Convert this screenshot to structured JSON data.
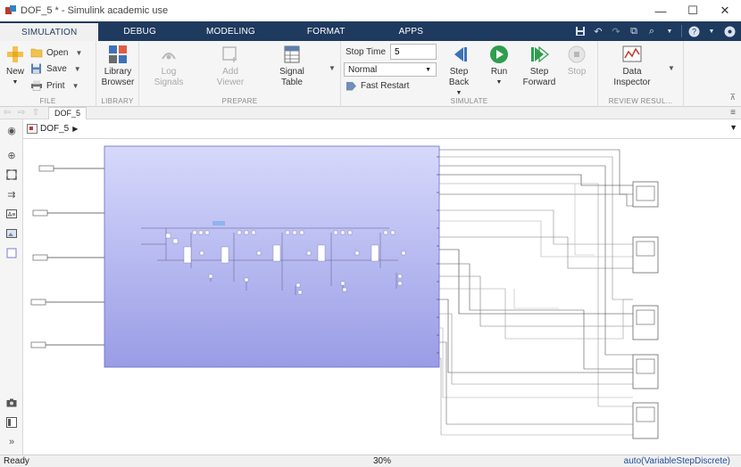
{
  "window": {
    "title": "DOF_5 * - Simulink academic use",
    "minimize": "—",
    "maximize": "☐",
    "close": "✕"
  },
  "tabs": [
    "SIMULATION",
    "DEBUG",
    "MODELING",
    "FORMAT",
    "APPS"
  ],
  "quick_access": {
    "save_icon": "save-icon",
    "undo_icon": "undo-icon",
    "redo_icon": "redo-icon",
    "search_icon": "search-icon",
    "help_icon": "help-icon"
  },
  "ribbon": {
    "file": {
      "label": "FILE",
      "new": "New",
      "open": "Open",
      "save": "Save",
      "print": "Print"
    },
    "library": {
      "label": "LIBRARY",
      "browser": "Library Browser"
    },
    "prepare": {
      "label": "PREPARE",
      "log_signals": "Log Signals",
      "add_viewer": "Add Viewer",
      "signal_table": "Signal Table"
    },
    "simulate": {
      "label": "SIMULATE",
      "stop_time_label": "Stop Time",
      "stop_time_value": "5",
      "mode": "Normal",
      "fast_restart": "Fast Restart",
      "step_back": "Step Back",
      "run": "Run",
      "step_forward": "Step Forward",
      "stop": "Stop"
    },
    "review": {
      "label": "REVIEW RESUL...",
      "data_inspector": "Data Inspector"
    }
  },
  "model_tab": "DOF_5",
  "breadcrumb": "DOF_5",
  "status": {
    "left": "Ready",
    "zoom": "30%",
    "solver": "auto(VariableStepDiscrete)"
  },
  "colors": {
    "tabbar": "#1f3a5f",
    "subsystem_top": "#d6d9fb",
    "subsystem_bottom": "#9a9ce6",
    "run_green": "#2e9e4f",
    "step_blue": "#3d72b8"
  }
}
